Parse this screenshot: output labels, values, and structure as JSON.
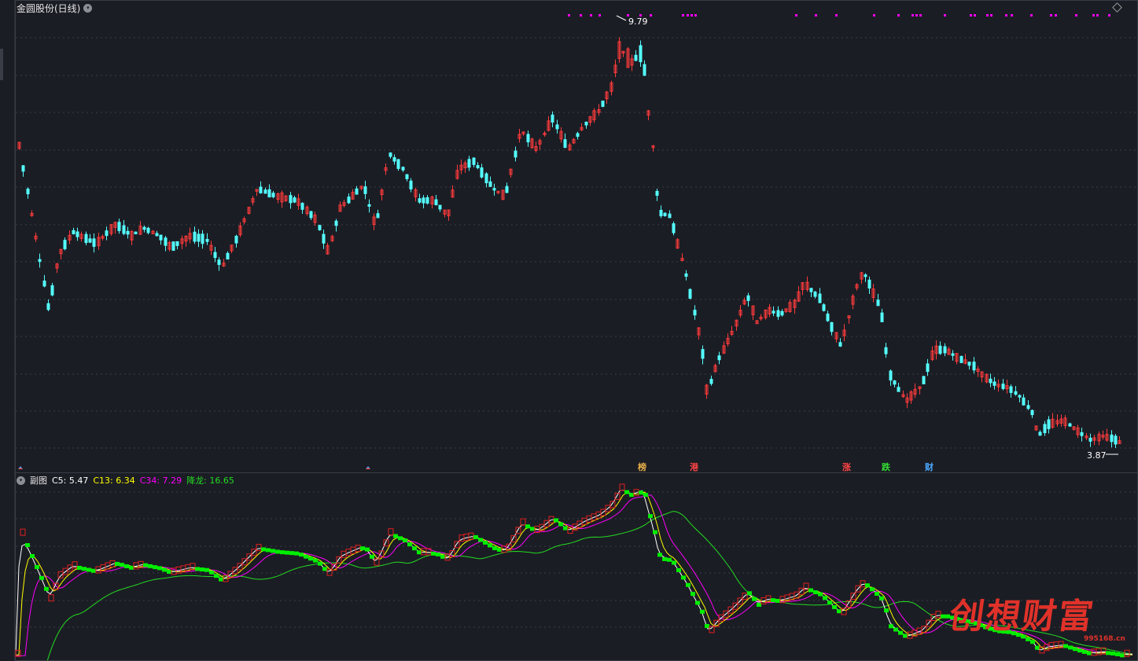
{
  "main_panel": {
    "title": "金圆股份(日线)",
    "high_label": "9.79",
    "low_label": "3.87"
  },
  "sub_panel": {
    "name": "副图",
    "c5_label": "C5: 5.47",
    "c13_label": "C13: 6.34",
    "c34_label": "C34: 7.29",
    "long_label": "降龙: 16.65"
  },
  "event_tags": [
    {
      "label": "榜",
      "color": "#e8b04a"
    },
    {
      "label": "港",
      "color": "#ff4444"
    },
    {
      "label": "涨",
      "color": "#ff4444"
    },
    {
      "label": "跌",
      "color": "#33dd33"
    },
    {
      "label": "财",
      "color": "#4aa8ff"
    }
  ],
  "watermark": {
    "text": "创想财富",
    "url": "995168.cn"
  },
  "colors": {
    "up": "#ff3b3b",
    "down": "#54ffff",
    "c5": "#ffffff",
    "c13": "#ffff00",
    "c34": "#ff00ff",
    "long": "#22dd22",
    "green_bar": "#00ee00",
    "grid": "#3a3d46",
    "signal": "#ff00ff"
  },
  "chart_data": {
    "type": "candlestick",
    "title": "金圆股份(日线)",
    "high": 9.79,
    "low": 3.87,
    "indicators": {
      "C5": 5.47,
      "C13": 6.34,
      "C34": 7.29,
      "降龙": 16.65
    }
  }
}
